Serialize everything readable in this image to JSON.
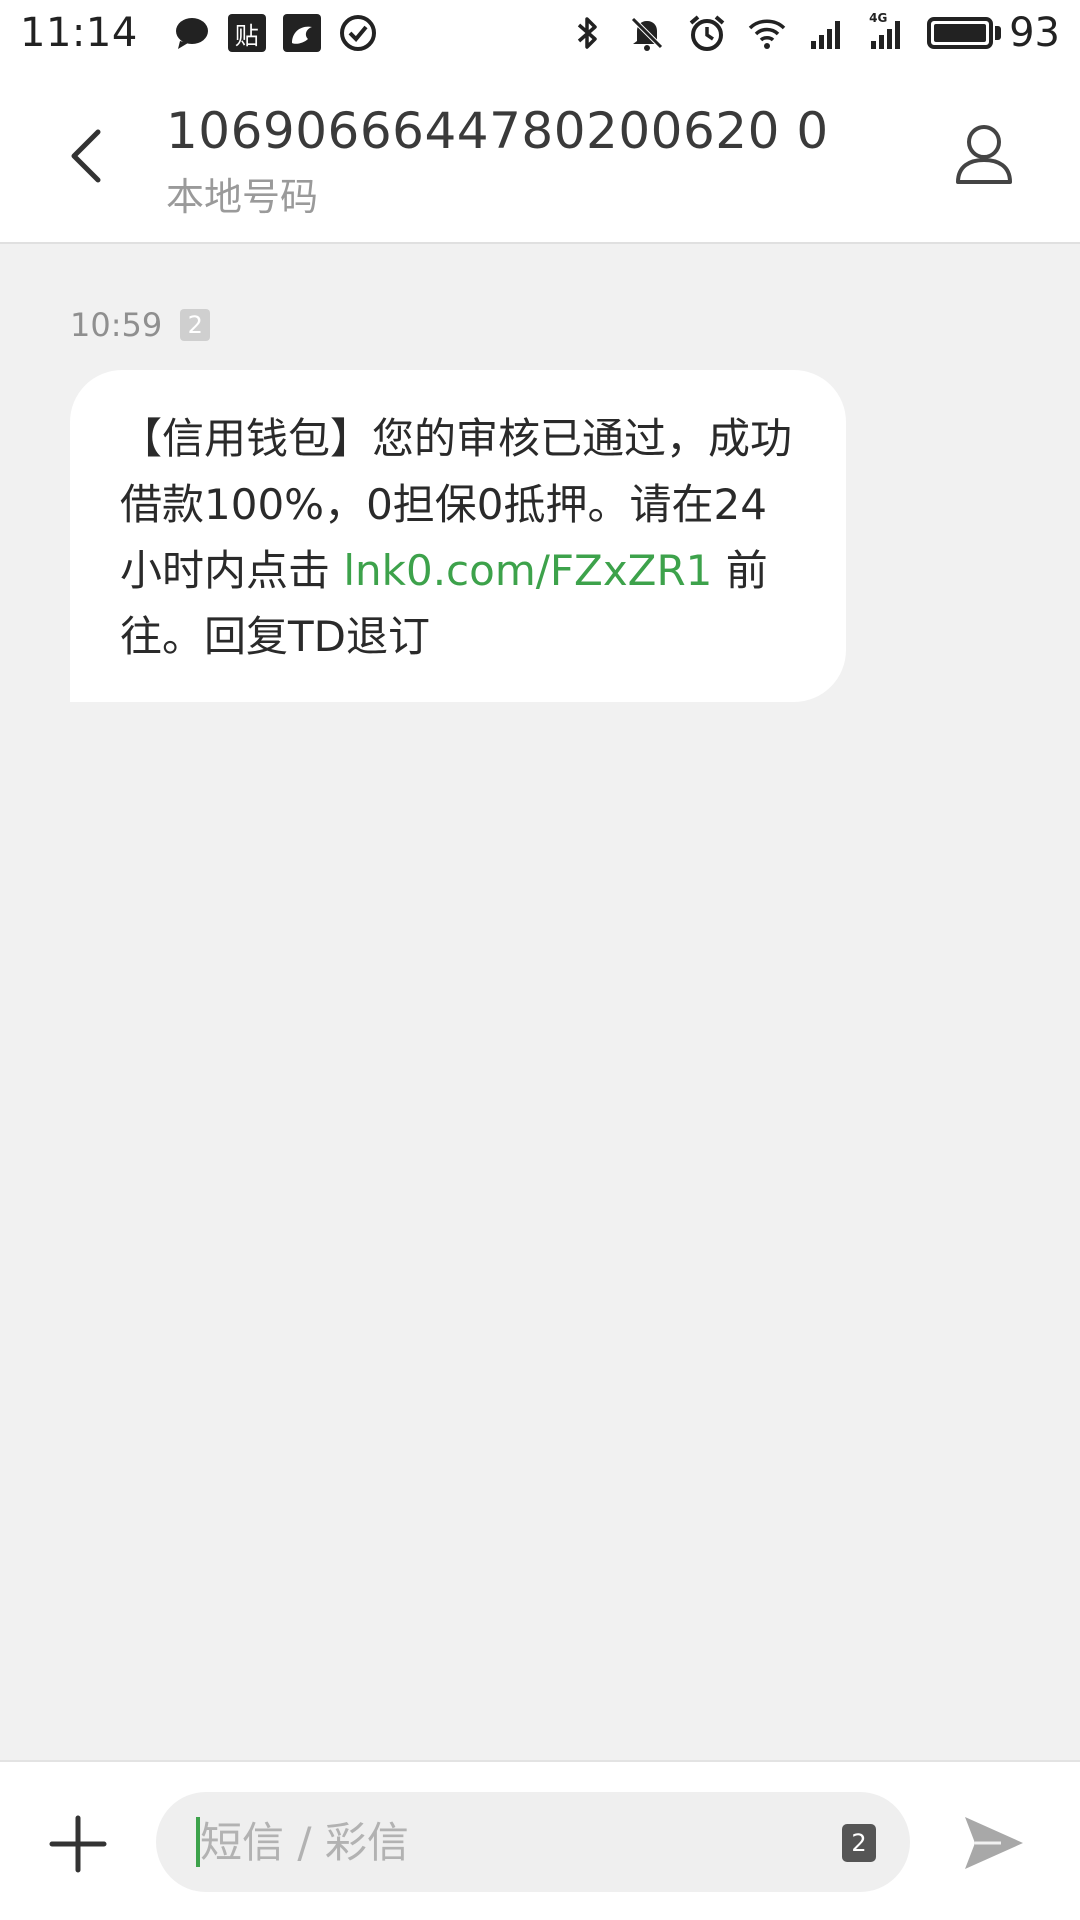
{
  "status_bar": {
    "time": "11:14",
    "app_badge_text": "贴",
    "battery_percent": "93",
    "battery_level": 0.93,
    "icons_left": [
      "chat-bubble-icon",
      "tieba-icon",
      "uc-browser-icon",
      "check-circle-icon"
    ],
    "icons_right": [
      "bluetooth-icon",
      "muted-bell-icon",
      "alarm-icon",
      "wifi-icon",
      "signal-icon",
      "signal-4g-icon",
      "battery-icon"
    ],
    "network_label": "4G"
  },
  "header": {
    "title": "1069066644780200620 0",
    "subtitle": "本地号码"
  },
  "message": {
    "timestamp": "10:59",
    "sim_slot": "2",
    "text_part1": "【信用钱包】您的审核已通过，成功借款100%，0担保0抵押。请在24小时内点击 ",
    "link_text": "lnk0.com/FZxZR1",
    "text_part2": " 前往。回复TD退订"
  },
  "composer": {
    "placeholder": "短信 / 彩信",
    "sim_slot": "2"
  },
  "colors": {
    "accent": "#3da24b",
    "background": "#f1f1f1",
    "bubble": "#ffffff"
  }
}
